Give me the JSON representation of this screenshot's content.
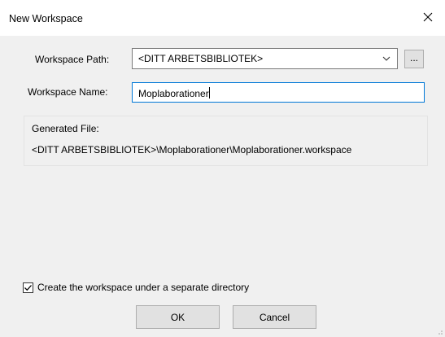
{
  "window": {
    "title": "New Workspace",
    "close_icon": "close-icon"
  },
  "form": {
    "path_label": "Workspace Path:",
    "path_value": "<DITT ARBETSBIBLIOTEK>",
    "path_dropdown_icon": "chevron-down-icon",
    "browse_label": "...",
    "name_label": "Workspace Name:",
    "name_value": "Moplaborationer"
  },
  "generated": {
    "label": "Generated File:",
    "path": "<DITT ARBETSBIBLIOTEK>\\Moplaborationer\\Moplaborationer.workspace"
  },
  "options": {
    "separate_dir_label": "Create the workspace under a separate directory",
    "separate_dir_checked": true
  },
  "buttons": {
    "ok": "OK",
    "cancel": "Cancel"
  },
  "colors": {
    "dialog_bg": "#f0f0f0",
    "focus_border": "#0078d7",
    "button_bg": "#e1e1e1"
  }
}
